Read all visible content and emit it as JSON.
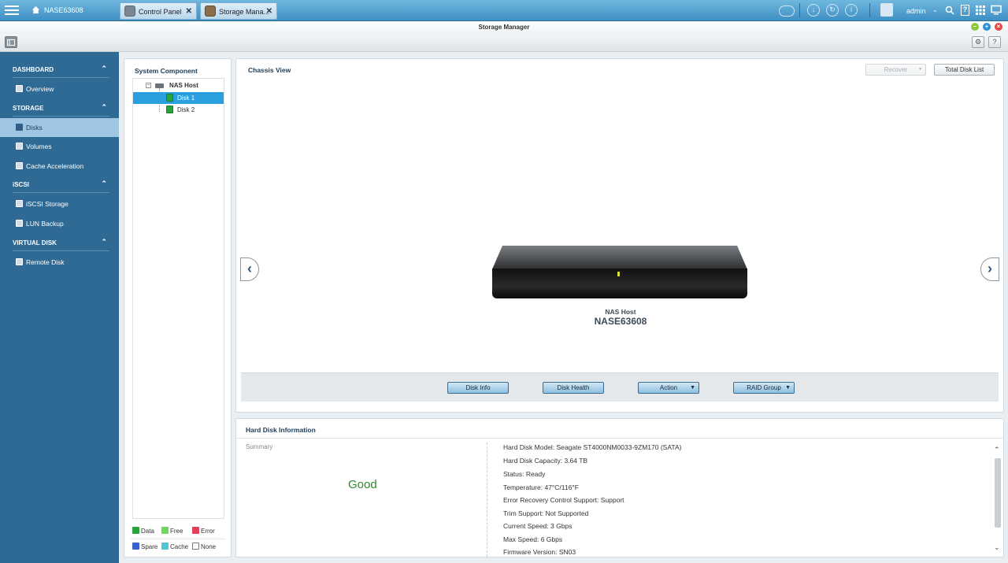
{
  "topbar": {
    "host_name": "NASE63608",
    "tabs": [
      {
        "label": "Control Panel",
        "close": "✕"
      },
      {
        "label": "Storage Mana...",
        "close": "✕"
      }
    ],
    "user": "admin",
    "icons": [
      "cloud-icon",
      "download-icon",
      "sync-icon",
      "info-icon",
      "user-icon",
      "search-icon",
      "help-icon",
      "apps-grid-icon",
      "monitor-icon"
    ]
  },
  "window": {
    "title": "Storage Manager"
  },
  "sidebar": {
    "sections": [
      {
        "label": "DASHBOARD",
        "items": [
          "Overview"
        ]
      },
      {
        "label": "STORAGE",
        "items": [
          "Disks",
          "Volumes",
          "Cache Acceleration"
        ]
      },
      {
        "label": "iSCSI",
        "items": [
          "iSCSI Storage",
          "LUN Backup"
        ]
      },
      {
        "label": "VIRTUAL DISK",
        "items": [
          "Remote Disk"
        ]
      }
    ],
    "active_item": "Disks"
  },
  "system_component": {
    "title": "System Component",
    "tree": {
      "host": "NAS Host",
      "disks": [
        "Disk 1",
        "Disk 2"
      ],
      "selected": "Disk 1"
    },
    "legend": [
      {
        "label": "Data",
        "color": "#27a53c"
      },
      {
        "label": "Free",
        "color": "#6fd85a"
      },
      {
        "label": "Error",
        "color": "#e0405a"
      },
      {
        "label": "Spare",
        "color": "#3a5fd0"
      },
      {
        "label": "Cache",
        "color": "#4fc6d8"
      },
      {
        "label": "None",
        "color": "#ffffff"
      }
    ]
  },
  "chassis": {
    "title": "Chassis View",
    "recover_label": "Recover",
    "total_disk_list_label": "Total Disk List",
    "device_label": "NAS Host",
    "device_name": "NASE63608",
    "actions": {
      "disk_info": "Disk Info",
      "disk_health": "Disk Health",
      "action": "Action",
      "raid_group": "RAID Group"
    }
  },
  "hard_disk_info": {
    "title": "Hard Disk Information",
    "summary_label": "Summary",
    "status_text": "Good",
    "status_color": "#2f8a2f",
    "lines": [
      "Hard Disk Model: Seagate ST4000NM0033-9ZM170 (SATA)",
      "Hard Disk Capacity: 3.64 TB",
      "Status: Ready",
      "Temperature: 47°C/116°F",
      "Error Recovery Control Support: Support",
      "Trim Support: Not Supported",
      "Current Speed: 3 Gbps",
      "Max Speed: 6 Gbps",
      "Firmware Version: SN03"
    ]
  }
}
